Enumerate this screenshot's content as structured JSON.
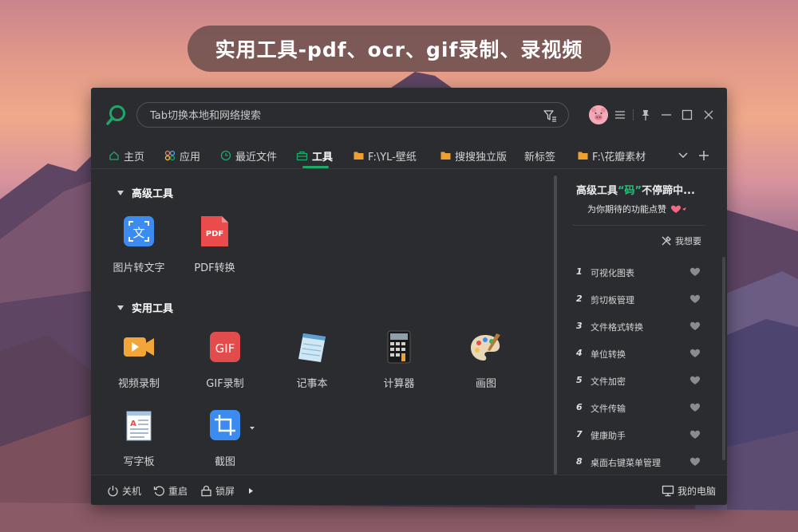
{
  "banner": {
    "text": "实用工具-pdf、ocr、gif录制、录视频"
  },
  "search": {
    "placeholder": "Tab切换本地和网络搜索"
  },
  "tabs": [
    {
      "label": "主页",
      "icon": "home-icon"
    },
    {
      "label": "应用",
      "icon": "apps-icon"
    },
    {
      "label": "最近文件",
      "icon": "clock-icon"
    },
    {
      "label": "工具",
      "icon": "toolbox-icon",
      "active": true
    },
    {
      "label": "F:\\YL-壁纸",
      "icon": "folder-icon"
    },
    {
      "label": "搜搜独立版",
      "icon": "folder-icon"
    },
    {
      "label": "新标签"
    },
    {
      "label": "F:\\花瓣素材",
      "icon": "folder-icon"
    }
  ],
  "sections": {
    "advanced": {
      "title": "高级工具",
      "tools": [
        {
          "label": "图片转文字",
          "icon": "ocr-icon"
        },
        {
          "label": "PDF转换",
          "icon": "pdf-icon",
          "badge": "PDF"
        }
      ]
    },
    "practical": {
      "title": "实用工具",
      "tools": [
        {
          "label": "视频录制",
          "icon": "video-camera-icon"
        },
        {
          "label": "GIF录制",
          "icon": "gif-icon",
          "badge": "GIF"
        },
        {
          "label": "记事本",
          "icon": "notepad-icon"
        },
        {
          "label": "计算器",
          "icon": "calculator-icon"
        },
        {
          "label": "画图",
          "icon": "paint-palette-icon"
        },
        {
          "label": "写字板",
          "icon": "wordpad-icon"
        },
        {
          "label": "截图",
          "icon": "crop-screenshot-icon"
        }
      ]
    }
  },
  "side": {
    "head_prefix": "高级工具",
    "head_highlight": "“码”",
    "head_suffix": "不停蹄中...",
    "subhead": "为你期待的功能点赞",
    "wish_label": "我想要",
    "items": [
      {
        "num": "1",
        "name": "可视化图表"
      },
      {
        "num": "2",
        "name": "剪切板管理"
      },
      {
        "num": "3",
        "name": "文件格式转换"
      },
      {
        "num": "4",
        "name": "单位转换"
      },
      {
        "num": "5",
        "name": "文件加密"
      },
      {
        "num": "6",
        "name": "文件传输"
      },
      {
        "num": "7",
        "name": "健康助手"
      },
      {
        "num": "8",
        "name": "桌面右键菜单管理"
      }
    ]
  },
  "footer": {
    "shutdown": "关机",
    "restart": "重启",
    "lock": "锁屏",
    "my_computer": "我的电脑"
  },
  "colors": {
    "accent": "#1ea868",
    "window_bg": "#2b2c30"
  }
}
